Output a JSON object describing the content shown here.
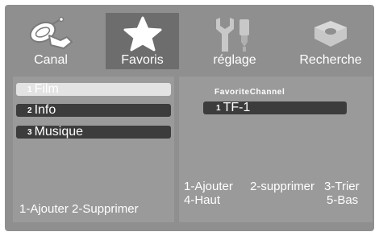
{
  "menu": {
    "tabs": [
      {
        "label": "Canal",
        "icon": "satellite-dish-icon",
        "active": false
      },
      {
        "label": "Favoris",
        "icon": "star-icon",
        "active": true
      },
      {
        "label": "réglage",
        "icon": "tools-icon",
        "active": false
      },
      {
        "label": "Recherche",
        "icon": "disc-icon",
        "active": false
      }
    ]
  },
  "favorites_lists": {
    "items": [
      {
        "num": "1",
        "label": "Film",
        "selected": true
      },
      {
        "num": "2",
        "label": "Info",
        "selected": false
      },
      {
        "num": "3",
        "label": "Musique",
        "selected": false
      }
    ],
    "help": "1-Ajouter 2-Supprimer"
  },
  "favorite_channel": {
    "title": "FavoriteChannel",
    "items": [
      {
        "num": "1",
        "label": "TF-1"
      }
    ],
    "help": {
      "add": "1-Ajouter",
      "delete": "2-supprimer",
      "sort": "3-Trier",
      "up": "4-Haut",
      "down": "5-Bas"
    }
  },
  "colors": {
    "background": "#8f8f8f",
    "panel": "#9a9a9a",
    "active_tab": "#6d6d6d",
    "item": "#3c3c3c",
    "selected_item": "#e3e3e3",
    "text": "#ffffff"
  }
}
